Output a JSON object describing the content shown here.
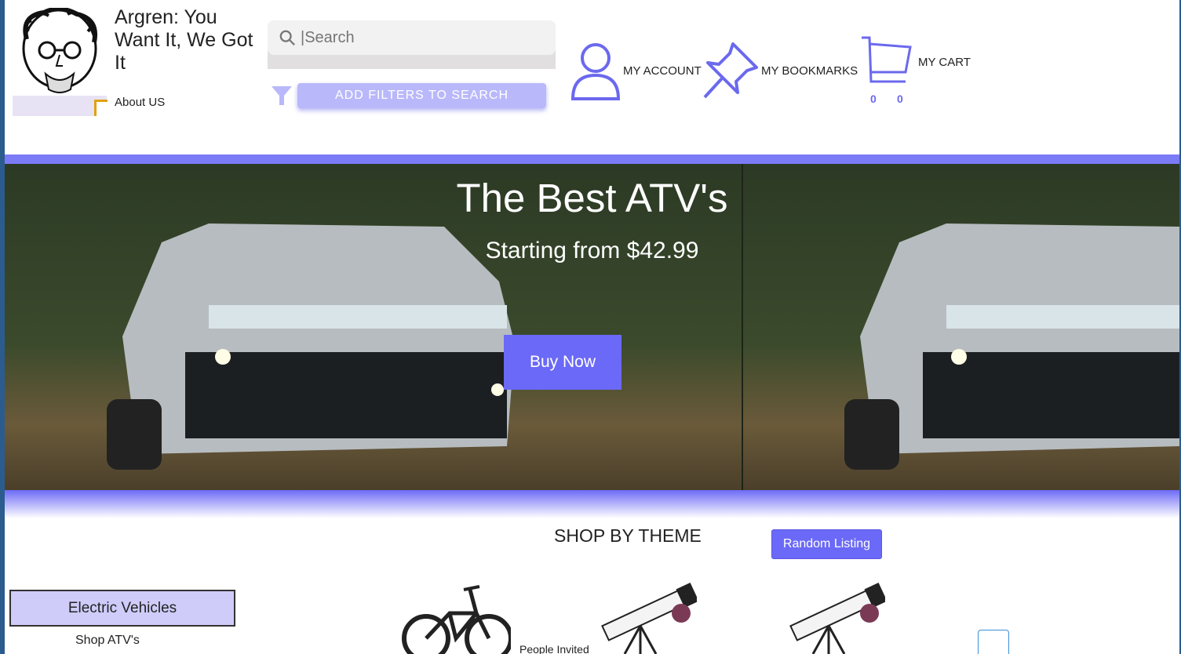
{
  "brand": {
    "title": "Argren: You Want It, We Got It",
    "about_link": "About US"
  },
  "search": {
    "value": "",
    "placeholder": "|Search",
    "filters_button": "ADD FILTERS TO SEARCH"
  },
  "nav": {
    "account": "MY ACCOUNT",
    "bookmarks": "MY BOOKMARKS",
    "cart": "MY CART",
    "cart_counts": [
      "0",
      "0"
    ]
  },
  "hero": {
    "title": "The Best ATV's",
    "subtitle": "Starting from $42.99",
    "button": "Buy Now"
  },
  "themes": {
    "heading": "SHOP BY THEME",
    "random_button": "Random Listing",
    "category": "Electric Vehicles",
    "sub_link": "Shop ATV's",
    "partial_text": "People Invited"
  },
  "colors": {
    "accent": "#6b69f7",
    "filter_button": "#b9b8fb",
    "category_bg": "#cfccfa"
  }
}
